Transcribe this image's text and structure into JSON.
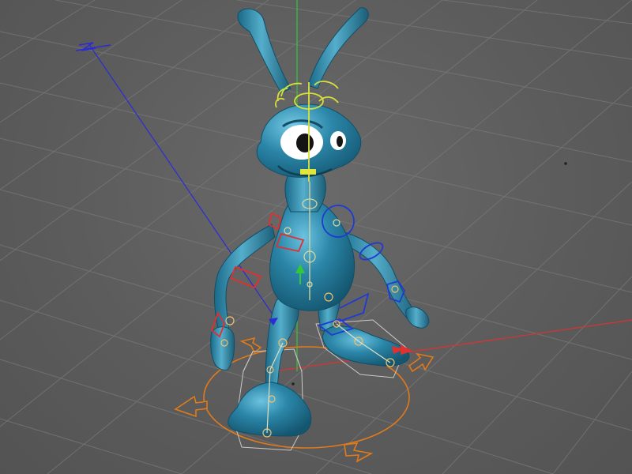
{
  "viewport": {
    "background": "#5b5b5b",
    "grid_color": "#7a7a7a",
    "axis_colors": {
      "x": "#e03030",
      "y": "#2fc93a",
      "z": "#2b2bd6"
    }
  },
  "character": {
    "body_color": "#2b86a8",
    "body_highlight": "#5fb8d6",
    "body_shadow": "#1b5e78",
    "eye_white": "#ffffff",
    "pupil": "#141414",
    "rig_bone_color": "#d6d6a0",
    "rig_joint_color": "#f0c070",
    "ik_handle_color": "#e07a1a",
    "head_controller_color": "#d9e03a",
    "spine_controller_color": "#d9e03a",
    "arm_controller_color": "#1f3bd1",
    "hand_controller_color": "#e03030",
    "foot_cage_color": "#c9c9c9"
  },
  "icons": {
    "scene_axis": "z-axis-label",
    "move_gizmo": "move-manipulator",
    "rotation_gizmo": "root-rotation-controller"
  }
}
